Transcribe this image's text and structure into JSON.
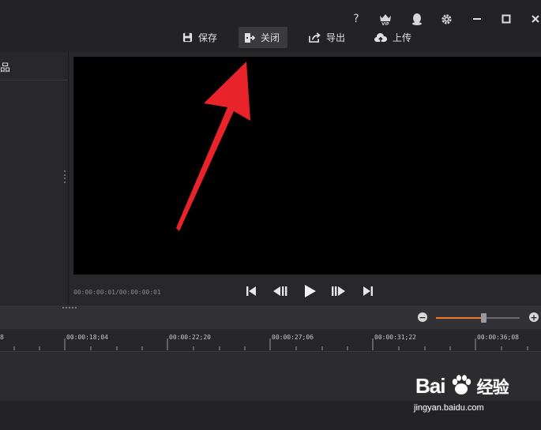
{
  "window": {
    "help_glyph": "?",
    "vip_label": "VIP",
    "icons": [
      "help-icon",
      "vip-crown-icon",
      "qq-penguin-icon",
      "gear-icon",
      "minimize-icon",
      "maximize-icon",
      "close-icon"
    ]
  },
  "toolbar": {
    "save_label": "保存",
    "close_label": "关闭",
    "export_label": "导出",
    "upload_label": "上传"
  },
  "left_panel": {
    "header_label": "品"
  },
  "preview": {
    "timecode": "00:00:00:01/00:00:00:01"
  },
  "timeline": {
    "ruler_labels": [
      "8",
      "00:00:18;04",
      "00:00:22;20",
      "00:00:27;06",
      "00:00:31;22",
      "00:00:36;08"
    ],
    "zoom_level": 0.57
  },
  "watermark": {
    "logo": "Bai🐾经验",
    "logo_text": "Bai",
    "logo_cn": "经验",
    "url": "jingyan.baidu.com"
  },
  "colors": {
    "accent": "#f07a2a",
    "arrow": "#e8232a"
  }
}
